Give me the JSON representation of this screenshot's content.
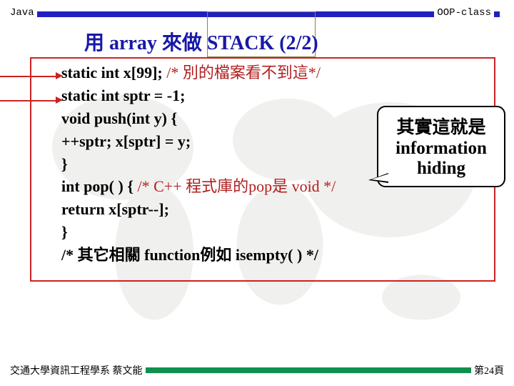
{
  "header": {
    "left": "Java",
    "right": "OOP-class"
  },
  "title": "用 array 來做 STACK  (2/2)",
  "code": {
    "l1a": "static int x[99];   ",
    "l1b": "/* 別的檔案看不到這*/",
    "l2": "static int sptr = -1;",
    "l3": "void push(int y) {",
    "l4": "       ++sptr;   x[sptr] = y;",
    "l5": "}",
    "l6a": "int pop( ) {   ",
    "l6b": "/* C++ 程式庫的pop是 void */",
    "l7": "       return x[sptr--];",
    "l8": "}",
    "l9": "/*  其它相關 function例如 isempty( )  */"
  },
  "callout": {
    "line1": "其實這就是",
    "line2": "information",
    "line3": "hiding"
  },
  "footer": {
    "left": "交通大學資訊工程學系 蔡文能",
    "right": "第24頁"
  }
}
